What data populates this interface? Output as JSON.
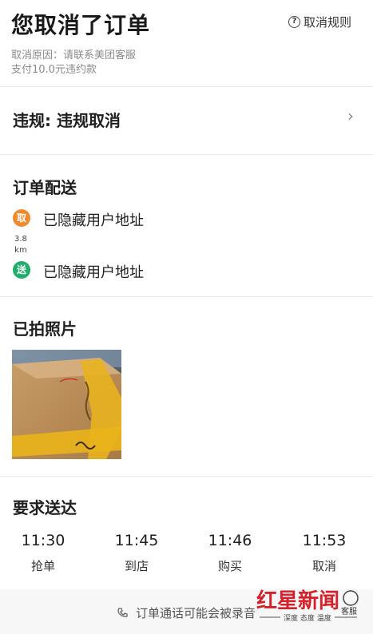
{
  "header": {
    "title": "您取消了订单",
    "rules_label": "取消规则",
    "reason": "取消原因：请联系美团客服",
    "penalty": "支付10.0元违约款"
  },
  "violation": {
    "label": "违规: 违规取消"
  },
  "delivery": {
    "heading": "订单配送",
    "pickup_badge": "取",
    "pickup_address": "已隐藏用户地址",
    "distance_value": "3.8",
    "distance_unit": "km",
    "drop_badge": "送",
    "drop_address": "已隐藏用户地址"
  },
  "photos": {
    "heading": "已拍照片"
  },
  "times": {
    "heading": "要求送达",
    "items": [
      {
        "time": "11:30",
        "label": "抢单"
      },
      {
        "time": "11:45",
        "label": "到店"
      },
      {
        "time": "11:46",
        "label": "购买"
      },
      {
        "time": "11:53",
        "label": "取消"
      }
    ]
  },
  "footer": {
    "recording_notice": "订单通话可能会被录音"
  },
  "watermark": {
    "brand": "红星新闻",
    "tagline": "深度 态度 温度",
    "service": "客服"
  },
  "colors": {
    "pickup": "#f08a2c",
    "drop": "#1fae6b",
    "watermark_red": "#d4212a"
  }
}
